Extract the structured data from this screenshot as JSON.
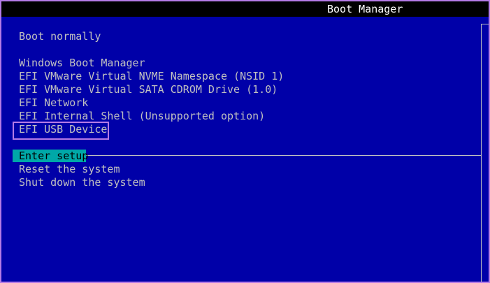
{
  "title": "Boot Manager",
  "boot_normally": "Boot normally",
  "boot_entries": [
    "Windows Boot Manager",
    "EFI VMware Virtual NVME Namespace (NSID 1)",
    "EFI VMware Virtual SATA CDROM Drive (1.0)",
    "EFI Network",
    "EFI Internal Shell (Unsupported option)",
    "EFI USB Device"
  ],
  "system_options": [
    "Enter setup",
    "Reset the system",
    "Shut down the system"
  ],
  "colors": {
    "background": "#0000a8",
    "text": "#c0c0c0",
    "title_text": "#ffffff",
    "selection": "#00a8a8",
    "annotation": "#b57be6"
  }
}
